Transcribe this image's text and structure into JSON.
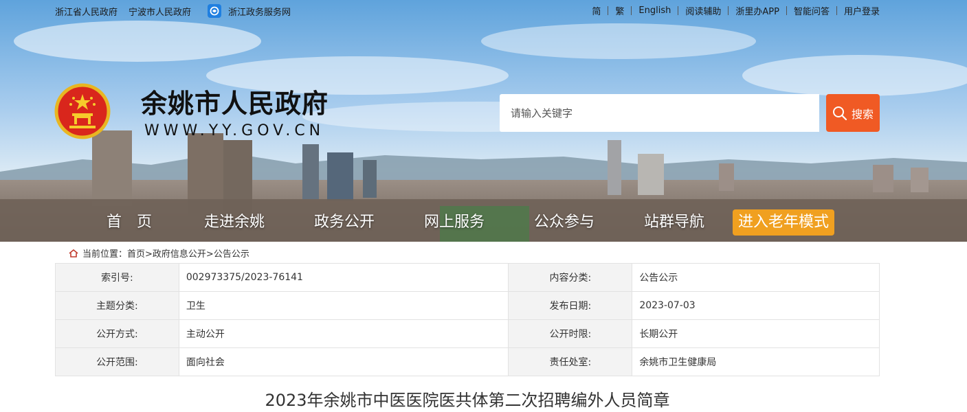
{
  "top_links_left": [
    "浙江省人民政府",
    "宁波市人民政府",
    "浙江政务服务网"
  ],
  "top_links_right": [
    "简",
    "繁",
    "English",
    "阅读辅助",
    "浙里办APP",
    "智能问答",
    "用户登录"
  ],
  "header": {
    "title": "余姚市人民政府",
    "url": "WWW.YY.GOV.CN"
  },
  "search": {
    "placeholder": "请输入关键字",
    "button_label": "搜索"
  },
  "nav": {
    "items": [
      "首　页",
      "走进余姚",
      "政务公开",
      "网上服务",
      "公众参与",
      "站群导航"
    ],
    "elder_mode": "进入老年模式"
  },
  "breadcrumb": {
    "prefix": "当前位置：",
    "items": [
      "首页>",
      "政府信息公开>",
      "公告公示"
    ]
  },
  "info": {
    "rows": [
      {
        "label1": "索引号:",
        "value1": "002973375/2023-76141",
        "label2": "内容分类:",
        "value2": "公告公示"
      },
      {
        "label1": "主题分类:",
        "value1": "卫生",
        "label2": "发布日期:",
        "value2": "2023-07-03"
      },
      {
        "label1": "公开方式:",
        "value1": "主动公开",
        "label2": "公开时限:",
        "value2": "长期公开"
      },
      {
        "label1": "公开范围:",
        "value1": "面向社会",
        "label2": "责任处室:",
        "value2": "余姚市卫生健康局"
      }
    ]
  },
  "article": {
    "title": "2023年余姚市中医医院医共体第二次招聘编外人员简章"
  },
  "colors": {
    "search_button": "#f05a24",
    "elder_button": "#f0a020",
    "table_label_bg": "#f3f3f3"
  }
}
